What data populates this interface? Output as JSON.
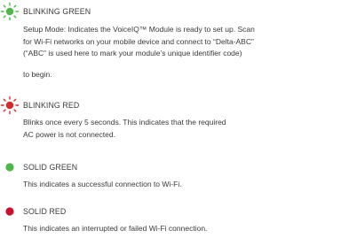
{
  "states": [
    {
      "title": "BLINKING GREEN",
      "color": "#4db848",
      "blinking": true,
      "icon": "blinking-led-icon",
      "lines": [
        "Setup Mode: Indicates the VoiceIQ™ Module is ready to set up. Scan",
        "for Wi-Fi networks on your mobile device and connect to “Delta-ABC”",
        "(“ABC” is used here to mark your module’s unique identifier code)"
      ],
      "tail": "to begin."
    },
    {
      "title": "BLINKING RED",
      "color": "#d62a2a",
      "blinking": true,
      "icon": "blinking-led-icon",
      "lines": [
        "Blinks once every 5 seconds. This indicates that the required",
        "AC power is not connected."
      ]
    },
    {
      "title": "SOLID GREEN",
      "color": "#4db848",
      "blinking": false,
      "icon": "solid-led-icon",
      "lines": [
        "This indicates a successful connection to Wi-Fi."
      ]
    },
    {
      "title": "SOLID RED",
      "color": "#c8102e",
      "blinking": false,
      "icon": "solid-led-icon",
      "lines": [
        "This indicates an interrupted or failed Wi-Fi connection."
      ]
    }
  ]
}
